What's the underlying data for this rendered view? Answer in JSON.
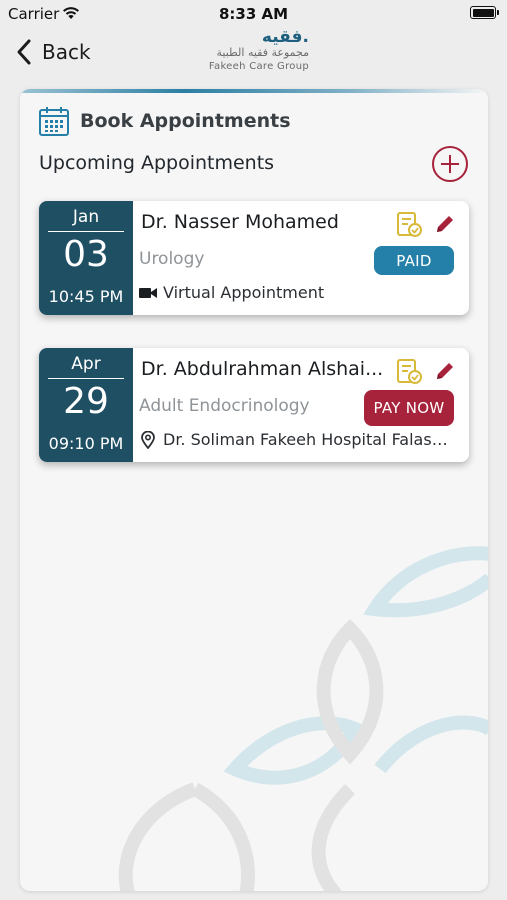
{
  "status_bar": {
    "carrier": "Carrier",
    "time": "8:33 AM"
  },
  "nav": {
    "back_label": "Back"
  },
  "logo": {
    "ar_mark": "فقيه.",
    "ar_text": "مجموعة فقيه الطبية",
    "en_text": "Fakeeh Care Group"
  },
  "book": {
    "title": "Book Appointments",
    "upcoming_title": "Upcoming Appointments"
  },
  "appointments": [
    {
      "month": "Jan",
      "day": "03",
      "time": "10:45 PM",
      "doctor": "Dr. Nasser Mohamed",
      "specialty": "Urology",
      "location_icon": "video-camera-icon",
      "location": "Virtual Appointment",
      "status": "PAID",
      "status_color": "#2580a9"
    },
    {
      "month": "Apr",
      "day": "29",
      "time": "09:10 PM",
      "doctor": "Dr. Abdulrahman Alshai...",
      "specialty": "Adult Endocrinology",
      "location_icon": "map-pin-icon",
      "location": "Dr. Soliman Fakeeh Hospital Falasti...",
      "status": "PAY NOW",
      "status_color": "#a7223b"
    }
  ],
  "colors": {
    "date_bg": "#1f4f63",
    "accent": "#2580a9",
    "alert": "#a7223b",
    "icon_yellow": "#d8b93a"
  }
}
